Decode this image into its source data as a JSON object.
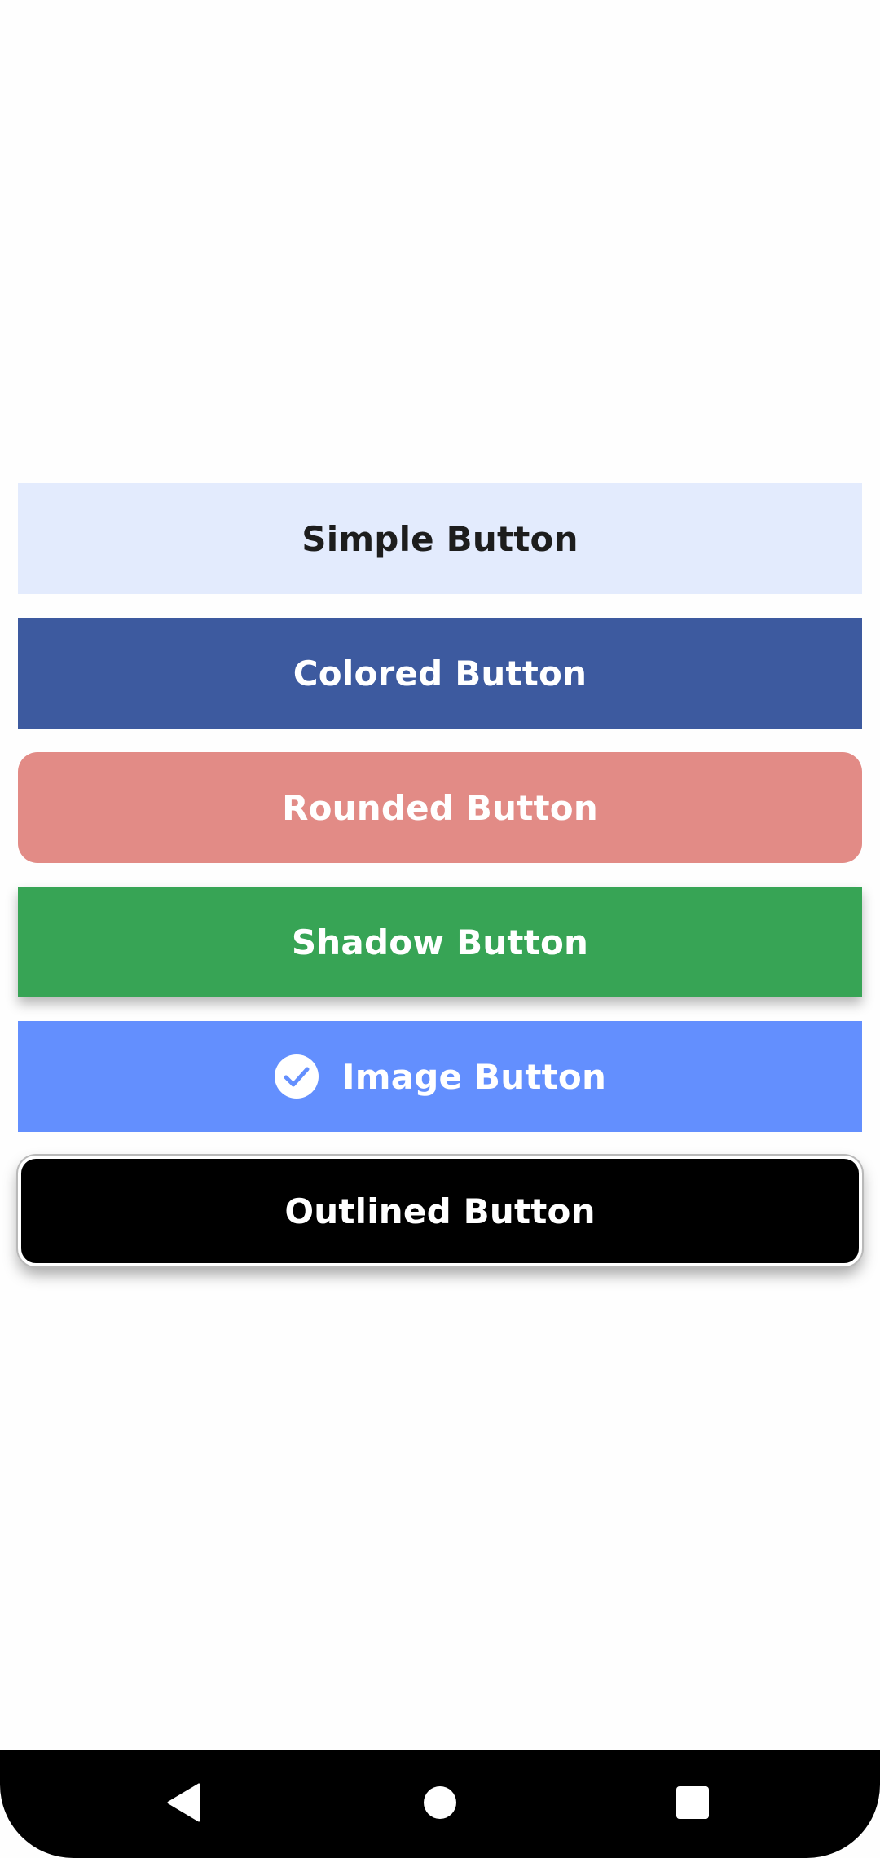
{
  "buttons": {
    "simple": {
      "label": "Simple Button",
      "bg": "#e3ebfd",
      "fg": "#1d1d1d"
    },
    "colored": {
      "label": "Colored Button",
      "bg": "#3d5a9f",
      "fg": "#ffffff"
    },
    "rounded": {
      "label": "Rounded Button",
      "bg": "#e28b86",
      "fg": "#ffffff"
    },
    "shadow": {
      "label": "Shadow Button",
      "bg": "#37a455",
      "fg": "#ffffff"
    },
    "image": {
      "label": "Image Button",
      "bg": "#638ffe",
      "fg": "#ffffff",
      "icon": "check-circle-icon"
    },
    "outlined": {
      "label": "Outlined Button",
      "bg": "#000000",
      "fg": "#ffffff",
      "border": "#ffffff"
    }
  },
  "navigation_bar": {
    "icons": [
      "back-icon",
      "home-icon",
      "recents-icon"
    ],
    "bg": "#000000"
  }
}
